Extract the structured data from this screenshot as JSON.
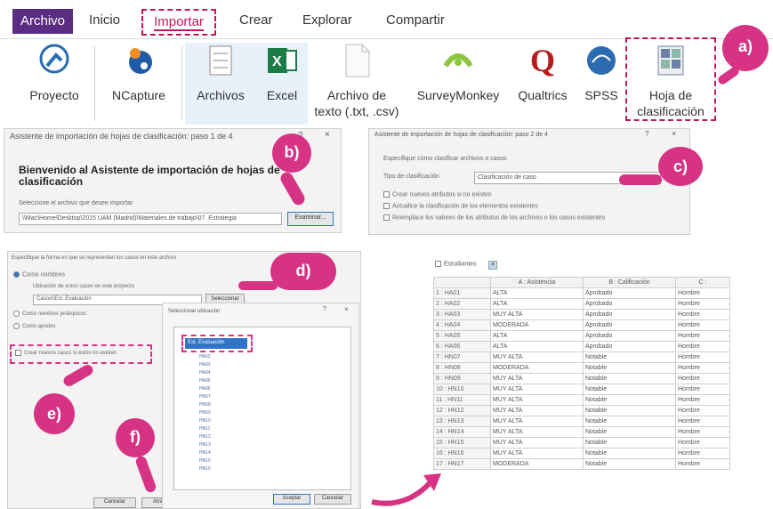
{
  "ribbon": {
    "tabs": [
      {
        "label": "Archivo"
      },
      {
        "label": "Inicio"
      },
      {
        "label": "Importar"
      },
      {
        "label": "Crear"
      },
      {
        "label": "Explorar"
      },
      {
        "label": "Compartir"
      }
    ],
    "buttons": [
      {
        "label": "Proyecto",
        "icon": "project-icon"
      },
      {
        "label": "NCapture",
        "icon": "ncapture-icon"
      },
      {
        "label": "Archivos",
        "icon": "files-icon"
      },
      {
        "label": "Excel",
        "icon": "excel-icon"
      },
      {
        "label_line1": "Archivo de",
        "label_line2": "texto (.txt, .csv)",
        "icon": "text-file-icon"
      },
      {
        "label": "SurveyMonkey",
        "icon": "surveymonkey-icon"
      },
      {
        "label": "Qualtrics",
        "icon": "qualtrics-icon"
      },
      {
        "label": "SPSS",
        "icon": "spss-icon"
      },
      {
        "label_line1": "Hoja de",
        "label_line2": "clasificación",
        "icon": "classification-sheet-icon"
      }
    ]
  },
  "badges": {
    "a": "a)",
    "b": "b)",
    "c": "c)",
    "d": "d)",
    "e": "e)",
    "f": "f)"
  },
  "wizard1": {
    "title": "Asistente de importación de hojas de clasificación: paso 1 de 4",
    "help": "?",
    "close": "×",
    "heading": "Bienvenido al Asistente de importación de hojas de clasificación",
    "select_label": "Seleccione el archivo que desee importar",
    "path": "\\\\Mac\\Home\\Desktop\\2015 UAM (Madrid)\\Materiales de trabajo\\07. Estrategia",
    "browse": "Examinar..."
  },
  "wizard2": {
    "title": "Asistente de importación de hojas de clasificación: paso 2 de 4",
    "help": "?",
    "close": "×",
    "prompt": "Especifique cómo clasificar archivos o casos",
    "type_label": "Tipo de clasificación",
    "type_value": "Clasificación de caso",
    "options": [
      "Crear nuevos atributos si no existen",
      "Actualice la clasificación de los elementos existentes",
      "Reemplace los valores de los atributos de los archivos o los casos existentes"
    ]
  },
  "wizard3": {
    "prompt": "Especifique la forma en que se representan los casos en este archivo",
    "radio1": "Como nombres",
    "location_label": "Ubicación de estos casos en este proyecto",
    "location_value": "Casos\\\\Est. Evaluación",
    "select_button": "Seleccionar",
    "radio2": "Como nombres jerárquicos",
    "radio3": "Como apodos",
    "create_new": "Crear nuevos casos si éstos no existen",
    "cancel": "Cancelar",
    "back": "Atrás"
  },
  "selector": {
    "title": "Seleccionar ubicación",
    "help": "?",
    "close": "×",
    "selected_node": "Est. Evaluación",
    "nodes": [
      "HA02",
      "HA03",
      "HA04",
      "HA05",
      "HA06",
      "HN07",
      "HN08",
      "HN09",
      "HN10",
      "HN11",
      "HN12",
      "HN13",
      "HN14",
      "HN15",
      "HN16"
    ],
    "accept": "Aceptar",
    "cancel": "Cancelar"
  },
  "table": {
    "toolbar_label": "Estudiantes",
    "headers": [
      "",
      "A : Asistencia",
      "B : Calificación",
      "C :"
    ],
    "rows": [
      [
        "1 : HA01",
        "ALTA",
        "Aprobado",
        "Hombre"
      ],
      [
        "2 : HA02",
        "ALTA",
        "Aprobado",
        "Hombre"
      ],
      [
        "3 : HA03",
        "MUY ALTA",
        "Aprobado",
        "Hombre"
      ],
      [
        "4 : HA04",
        "MODERADA",
        "Aprobado",
        "Hombre"
      ],
      [
        "5 : HA05",
        "ALTA",
        "Aprobado",
        "Hombre"
      ],
      [
        "6 : HA06",
        "ALTA",
        "Aprobado",
        "Hombre"
      ],
      [
        "7 : HN07",
        "MUY ALTA",
        "Notable",
        "Hombre"
      ],
      [
        "8 : HN08",
        "MODERADA",
        "Notable",
        "Hombre"
      ],
      [
        "9 : HN09",
        "MUY ALTA",
        "Notable",
        "Hombre"
      ],
      [
        "10 : HN10",
        "MUY ALTA",
        "Notable",
        "Hombre"
      ],
      [
        "11 : HN11",
        "MUY ALTA",
        "Notable",
        "Hombre"
      ],
      [
        "12 : HN12",
        "MUY ALTA",
        "Notable",
        "Hombre"
      ],
      [
        "13 : HN13",
        "MUY ALTA",
        "Notable",
        "Hombre"
      ],
      [
        "14 : HN14",
        "MUY ALTA",
        "Notable",
        "Hombre"
      ],
      [
        "15 : HN15",
        "MUY ALTA",
        "Notable",
        "Hombre"
      ],
      [
        "16 : HN16",
        "MUY ALTA",
        "Notable",
        "Hombre"
      ],
      [
        "17 : HN17",
        "MODERADA",
        "Notable",
        "Hombre"
      ]
    ]
  },
  "colors": {
    "accent": "#d63384",
    "archivo_tab": "#5a2d82",
    "selection": "#3173c6"
  }
}
